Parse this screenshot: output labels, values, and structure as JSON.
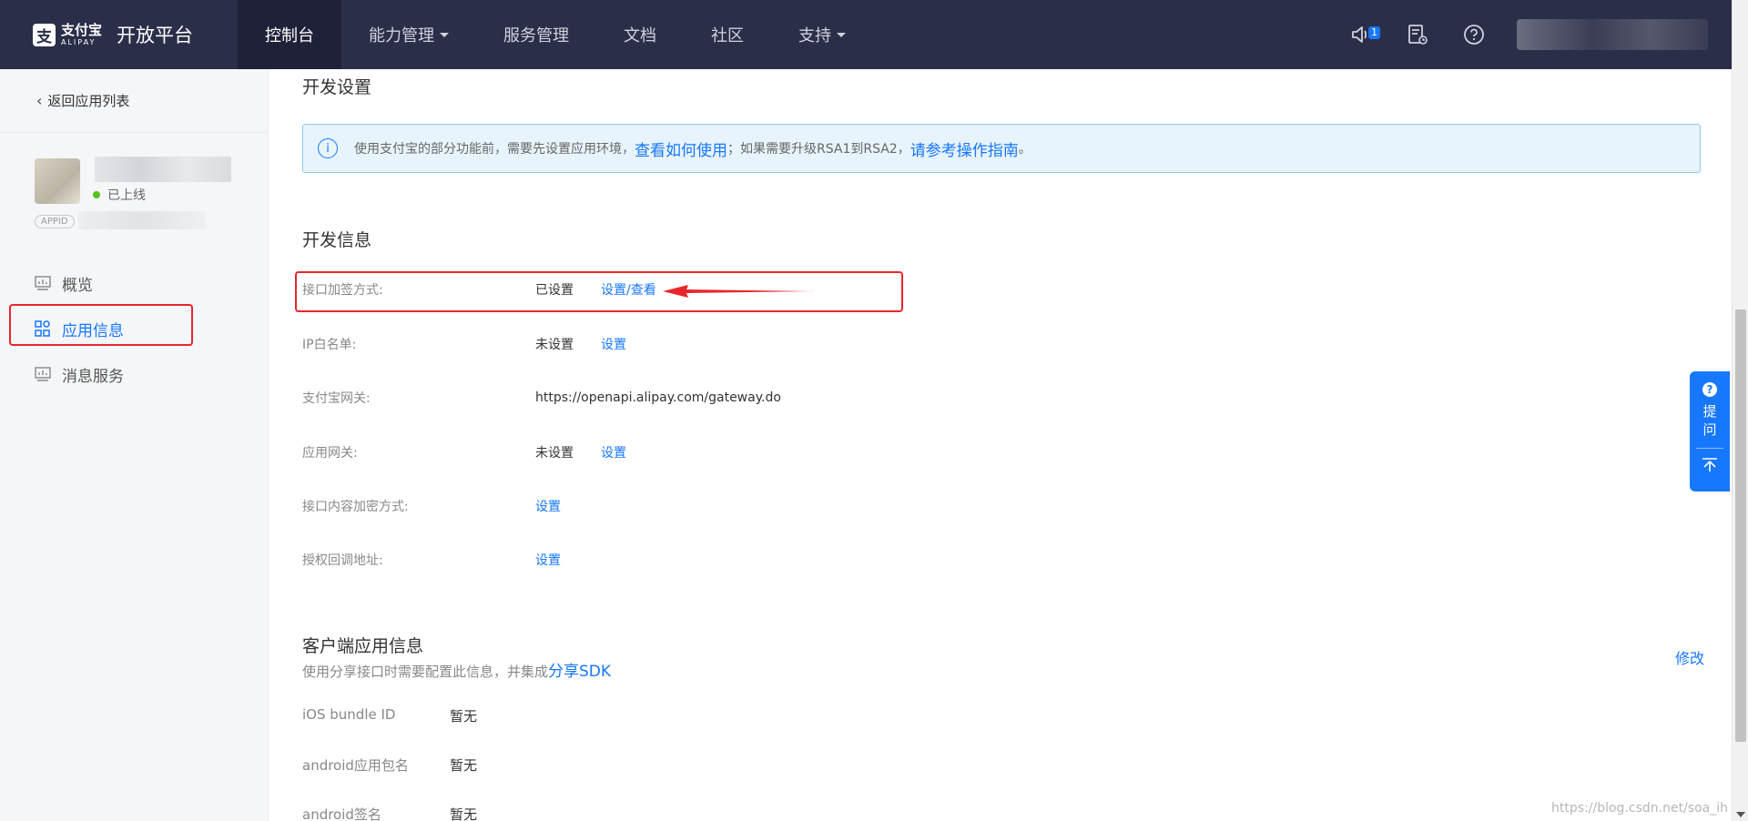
{
  "topbar": {
    "logo_zh": "支付宝",
    "logo_en": "ALIPAY",
    "platform_name": "开放平台",
    "nav": [
      {
        "label": "控制台",
        "active": true
      },
      {
        "label": "能力管理",
        "dropdown": true
      },
      {
        "label": "服务管理"
      },
      {
        "label": "文档"
      },
      {
        "label": "社区"
      },
      {
        "label": "支持",
        "dropdown": true
      }
    ],
    "notification_count": "1"
  },
  "sidebar": {
    "back_label": "返回应用列表",
    "app_status": "已上线",
    "appid_tag": "APPID",
    "menu": [
      {
        "label": "概览",
        "icon": "chart-icon"
      },
      {
        "label": "应用信息",
        "icon": "grid-icon",
        "active": true
      },
      {
        "label": "消息服务",
        "icon": "chart-icon"
      }
    ]
  },
  "main": {
    "dev_settings_title": "开发设置",
    "alert": {
      "text1": "使用支付宝的部分功能前，需要先设置应用环境，",
      "link1": "查看如何使用",
      "text2": "；如果需要升级RSA1到RSA2，",
      "link2": "请参考操作指南",
      "text3": "。"
    },
    "dev_info_title": "开发信息",
    "rows": [
      {
        "label": "接口加签方式:",
        "value": "已设置",
        "action": "设置/查看"
      },
      {
        "label": "IP白名单:",
        "value": "未设置",
        "action": "设置"
      },
      {
        "label": "支付宝网关:",
        "value": "https://openapi.alipay.com/gateway.do",
        "action": ""
      },
      {
        "label": "应用网关:",
        "value": "未设置",
        "action": "设置"
      },
      {
        "label": "接口内容加密方式:",
        "value": "",
        "action": "设置"
      },
      {
        "label": "授权回调地址:",
        "value": "",
        "action": "设置"
      }
    ],
    "client_title": "客户端应用信息",
    "client_subtitle": "使用分享接口时需要配置此信息，并集成",
    "client_subtitle_link": "分享SDK",
    "modify_label": "修改",
    "client_rows": [
      {
        "label": "iOS bundle ID",
        "value": "暂无"
      },
      {
        "label": "android应用包名",
        "value": "暂无"
      },
      {
        "label": "android签名",
        "value": "暂无"
      }
    ]
  },
  "float_help": {
    "label": "提问"
  },
  "watermark": "https://blog.csdn.net/soa_ih",
  "colors": {
    "brand": "#1677ff",
    "topbar": "#2b2e49",
    "highlight": "#e8262d"
  }
}
